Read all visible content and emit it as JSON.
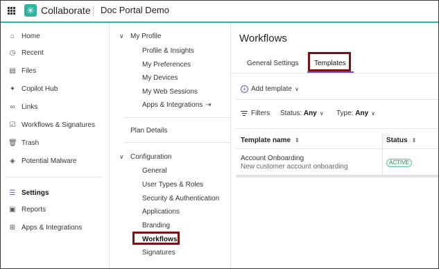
{
  "app": {
    "brand": "Collaborate",
    "project": "Doc Portal Demo"
  },
  "sidebar": {
    "items": [
      {
        "label": "Home",
        "icon": "home-icon"
      },
      {
        "label": "Recent",
        "icon": "clock-icon"
      },
      {
        "label": "Files",
        "icon": "files-icon"
      },
      {
        "label": "Copilot Hub",
        "icon": "sparkle-icon"
      },
      {
        "label": "Links",
        "icon": "link-icon"
      },
      {
        "label": "Workflows & Signatures",
        "icon": "workflow-icon"
      },
      {
        "label": "Trash",
        "icon": "trash-icon"
      },
      {
        "label": "Potential Malware",
        "icon": "shield-icon"
      },
      {
        "label": "Settings",
        "icon": "sliders-icon",
        "active": true
      },
      {
        "label": "Reports",
        "icon": "report-icon"
      },
      {
        "label": "Apps & Integrations",
        "icon": "apps-icon"
      }
    ]
  },
  "settings_nav": {
    "my_profile": {
      "label": "My Profile",
      "items": [
        "Profile & Insights",
        "My Preferences",
        "My Devices",
        "My Web Sessions",
        "Apps & Integrations"
      ]
    },
    "plan_details": "Plan Details",
    "configuration": {
      "label": "Configuration",
      "items": [
        "General",
        "User Types & Roles",
        "Security & Authentication",
        "Applications",
        "Branding",
        "Workflows",
        "Signatures"
      ]
    }
  },
  "main": {
    "title": "Workflows",
    "tabs": [
      "General Settings",
      "Templates"
    ],
    "active_tab": "Templates",
    "add_template": "Add template",
    "filters": {
      "label": "Filters",
      "status_label": "Status:",
      "status_value": "Any",
      "type_label": "Type:",
      "type_value": "Any"
    },
    "table": {
      "columns": [
        "Template name",
        "Status"
      ],
      "rows": [
        {
          "name": "Account Onboarding",
          "description": "New customer account onboarding",
          "status": "ACTIVE"
        }
      ]
    }
  },
  "colors": {
    "accent": "#2fb3a0",
    "tab_underline": "#6a4fd8",
    "highlight_box": "#7a1115",
    "status_active": "#2a8a5a"
  }
}
